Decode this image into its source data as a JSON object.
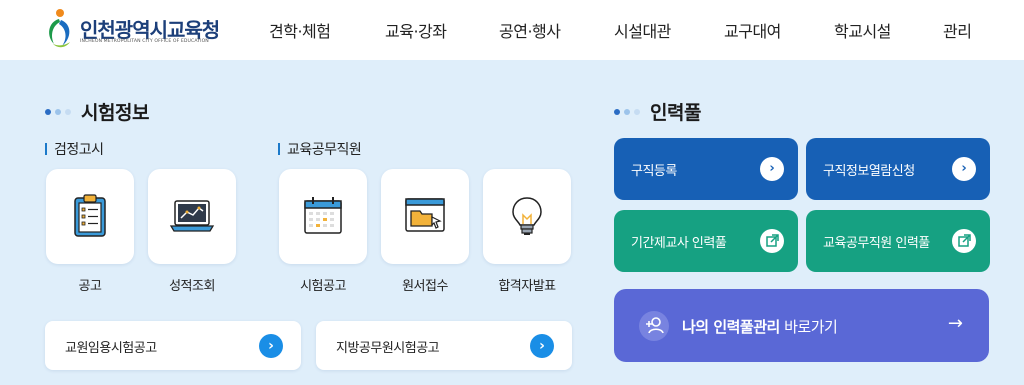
{
  "header": {
    "logo_title": "인천광역시교육청",
    "logo_subtitle": "INCHEON METROPOLITAN CITY OFFICE OF EDUCATION",
    "nav": [
      "견학·체험",
      "교육·강좌",
      "공연·행사",
      "시설대관",
      "교구대여",
      "학교시설",
      "관리"
    ]
  },
  "exam": {
    "title": "시험정보",
    "group1_title": "검정고시",
    "group2_title": "교육공무직원",
    "cards": [
      "공고",
      "성적조회",
      "시험공고",
      "원서접수",
      "합격자발표"
    ],
    "links": [
      "교원임용시험공고",
      "지방공무원시험공고"
    ]
  },
  "pool": {
    "title": "인력풀",
    "buttons": [
      "구직등록",
      "구직정보열람신청",
      "기간제교사 인력풀",
      "교육공무직원 인력풀"
    ],
    "my_strong": "나의 인력풀관리",
    "my_rest": " 바로가기"
  },
  "colors": {
    "background": "#dfeefa",
    "blue_button": "#1760b5",
    "green_button": "#16a182",
    "my_pool_button": "#5a68d6",
    "link_arrow": "#1a8ee6"
  },
  "icons": [
    "clipboard-icon",
    "laptop-chart-icon",
    "calendar-icon",
    "folder-window-icon",
    "lightbulb-icon",
    "chevron-right-icon",
    "external-link-icon",
    "person-add-icon",
    "arrow-right-icon"
  ]
}
